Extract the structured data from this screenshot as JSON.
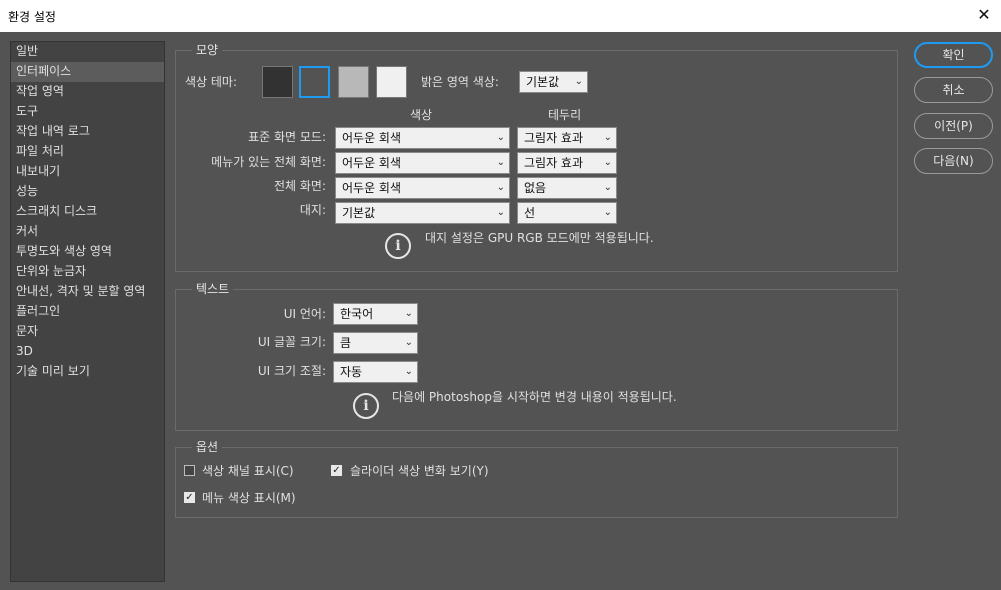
{
  "window": {
    "title": "환경 설정"
  },
  "sidebar": {
    "items": [
      {
        "label": "일반",
        "selected": false
      },
      {
        "label": "인터페이스",
        "selected": true
      },
      {
        "label": "작업 영역",
        "selected": false
      },
      {
        "label": "도구",
        "selected": false
      },
      {
        "label": "작업 내역 로그",
        "selected": false
      },
      {
        "label": "파일 처리",
        "selected": false
      },
      {
        "label": "내보내기",
        "selected": false
      },
      {
        "label": "성능",
        "selected": false
      },
      {
        "label": "스크래치 디스크",
        "selected": false
      },
      {
        "label": "커서",
        "selected": false
      },
      {
        "label": "투명도와 색상 영역",
        "selected": false
      },
      {
        "label": "단위와 눈금자",
        "selected": false
      },
      {
        "label": "안내선, 격자 및 분할 영역",
        "selected": false
      },
      {
        "label": "플러그인",
        "selected": false
      },
      {
        "label": "문자",
        "selected": false
      },
      {
        "label": "3D",
        "selected": false
      },
      {
        "label": "기술 미리 보기",
        "selected": false
      }
    ]
  },
  "appearance": {
    "title": "모양",
    "color_theme_label": "색상 테마:",
    "themes": [
      {
        "color": "#323232"
      },
      {
        "color": "#535353",
        "selected": true
      },
      {
        "color": "#b8b8b8"
      },
      {
        "color": "#f0f0f0"
      }
    ],
    "highlight_label": "밝은 영역 색상:",
    "highlight_value": "기본값",
    "col_color": "색상",
    "col_border": "테두리",
    "rows": [
      {
        "label": "표준 화면 모드:",
        "color": "어두운 회색",
        "border": "그림자 효과"
      },
      {
        "label": "메뉴가 있는 전체 화면:",
        "color": "어두운 회색",
        "border": "그림자 효과"
      },
      {
        "label": "전체 화면:",
        "color": "어두운 회색",
        "border": "없음"
      },
      {
        "label": "대지:",
        "color": "기본값",
        "border": "선"
      }
    ],
    "info": "대지 설정은 GPU RGB 모드에만 적용됩니다."
  },
  "text": {
    "title": "텍스트",
    "ui_language_label": "UI 언어:",
    "ui_language": "한국어",
    "ui_font_size_label": "UI 글꼴 크기:",
    "ui_font_size": "큼",
    "ui_scale_label": "UI 크기 조절:",
    "ui_scale": "자동",
    "info": "다음에 Photoshop을 시작하면 변경 내용이 적용됩니다."
  },
  "options": {
    "title": "옵션",
    "color_channels": {
      "label": "색상 채널 표시(C)",
      "checked": false
    },
    "slider_gradients": {
      "label": "슬라이더 색상 변화 보기(Y)",
      "checked": true
    },
    "menu_colors": {
      "label": "메뉴 색상 표시(M)",
      "checked": true
    }
  },
  "buttons": {
    "ok": "확인",
    "cancel": "취소",
    "prev": "이전(P)",
    "next": "다음(N)"
  },
  "colors": {
    "accent": "#1e9bf0",
    "panel": "#535353",
    "sidebar": "#434343"
  }
}
